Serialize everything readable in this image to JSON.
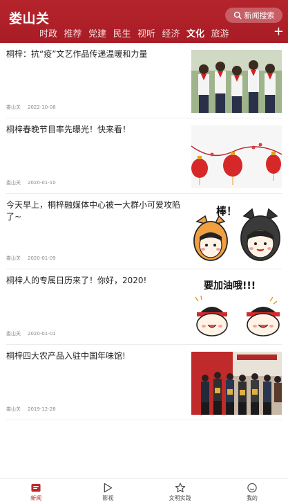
{
  "header": {
    "logo": "娄山关",
    "search_label": "新闻搜索",
    "tabs": [
      {
        "label": "时政",
        "active": false
      },
      {
        "label": "推荐",
        "active": false
      },
      {
        "label": "党建",
        "active": false
      },
      {
        "label": "民生",
        "active": false
      },
      {
        "label": "视听",
        "active": false
      },
      {
        "label": "经济",
        "active": false
      },
      {
        "label": "文化",
        "active": true
      },
      {
        "label": "旅游",
        "active": false
      }
    ],
    "plus_label": "+"
  },
  "articles": [
    {
      "title": "桐梓：抗“疫”文艺作品传递温暖和力量",
      "source": "娄山关",
      "date": "2022-10-08",
      "thumb": "children-photo"
    },
    {
      "title": "桐梓春晚节目率先曝光！快来看！",
      "source": "娄山关",
      "date": "2020-01-10",
      "thumb": "lanterns"
    },
    {
      "title": "今天早上，桐梓融媒体中心被一大群小可爱攻陷了~",
      "source": "娄山关",
      "date": "2020-01-09",
      "thumb": "cartoon-dogs",
      "thumb_text": "棒！"
    },
    {
      "title": "桐梓人的专属日历来了！你好，2020!",
      "source": "娄山关",
      "date": "2020-01-01",
      "thumb": "cartoon-cheer",
      "thumb_text": "要加油哦!!!"
    },
    {
      "title": "桐梓四大农产品入驻中国年味馆!",
      "source": "娄山关",
      "date": "2019-12-28",
      "thumb": "group-photo"
    }
  ],
  "tabbar": [
    {
      "label": "新闻",
      "icon": "news-icon",
      "active": true
    },
    {
      "label": "影视",
      "icon": "play-icon",
      "active": false
    },
    {
      "label": "文明实践",
      "icon": "star-icon",
      "active": false
    },
    {
      "label": "我的",
      "icon": "smile-icon",
      "active": false
    }
  ],
  "colors": {
    "brand": "#b5242c",
    "active_tab": "#c0272d"
  }
}
